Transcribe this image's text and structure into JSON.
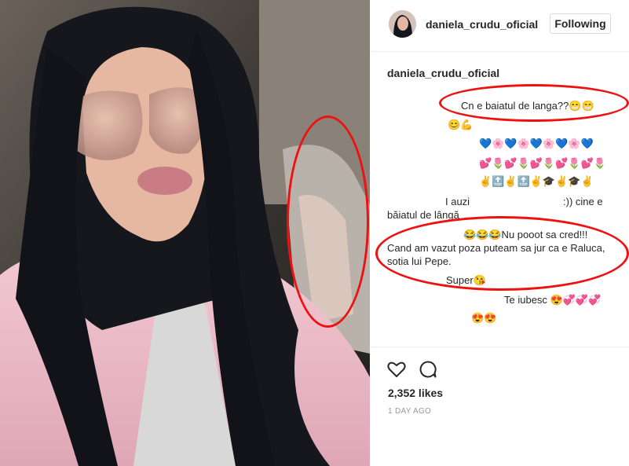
{
  "header": {
    "username": "daniela_crudu_oficial",
    "follow_label": "Following"
  },
  "caption": {
    "username": "daniela_crudu_oficial"
  },
  "comments": {
    "c1": "Cn e baiatul de langa??😁😁",
    "c2": "😊💪",
    "c3": "💙🌸💙🌸💙🌸💙🌸💙",
    "c4": "💕🌷💕🌷💕🌷💕🌷💕🌷",
    "c5": "✌🔝✌🔝✌🎓✌🎓✌",
    "c6a": "I auzi",
    "c6b": ":)) cine e",
    "c6c": "băiatul de lângă",
    "c7": "😂😂😂Nu pooot sa cred!!!",
    "c8": "Cand am vazut poza puteam sa jur ca e Raluca,",
    "c9": "sotia lui Pepe.",
    "c10": "Super😘",
    "c11": "Te iubesc 😍💞💞💞",
    "c12": "😍😍"
  },
  "likes": "2,352 likes",
  "time": "1 DAY AGO",
  "colors": {
    "annotation_red": "#e11111",
    "jacket_pink": "#e8b8c4"
  },
  "icons": [
    "heart-icon",
    "comment-icon"
  ]
}
